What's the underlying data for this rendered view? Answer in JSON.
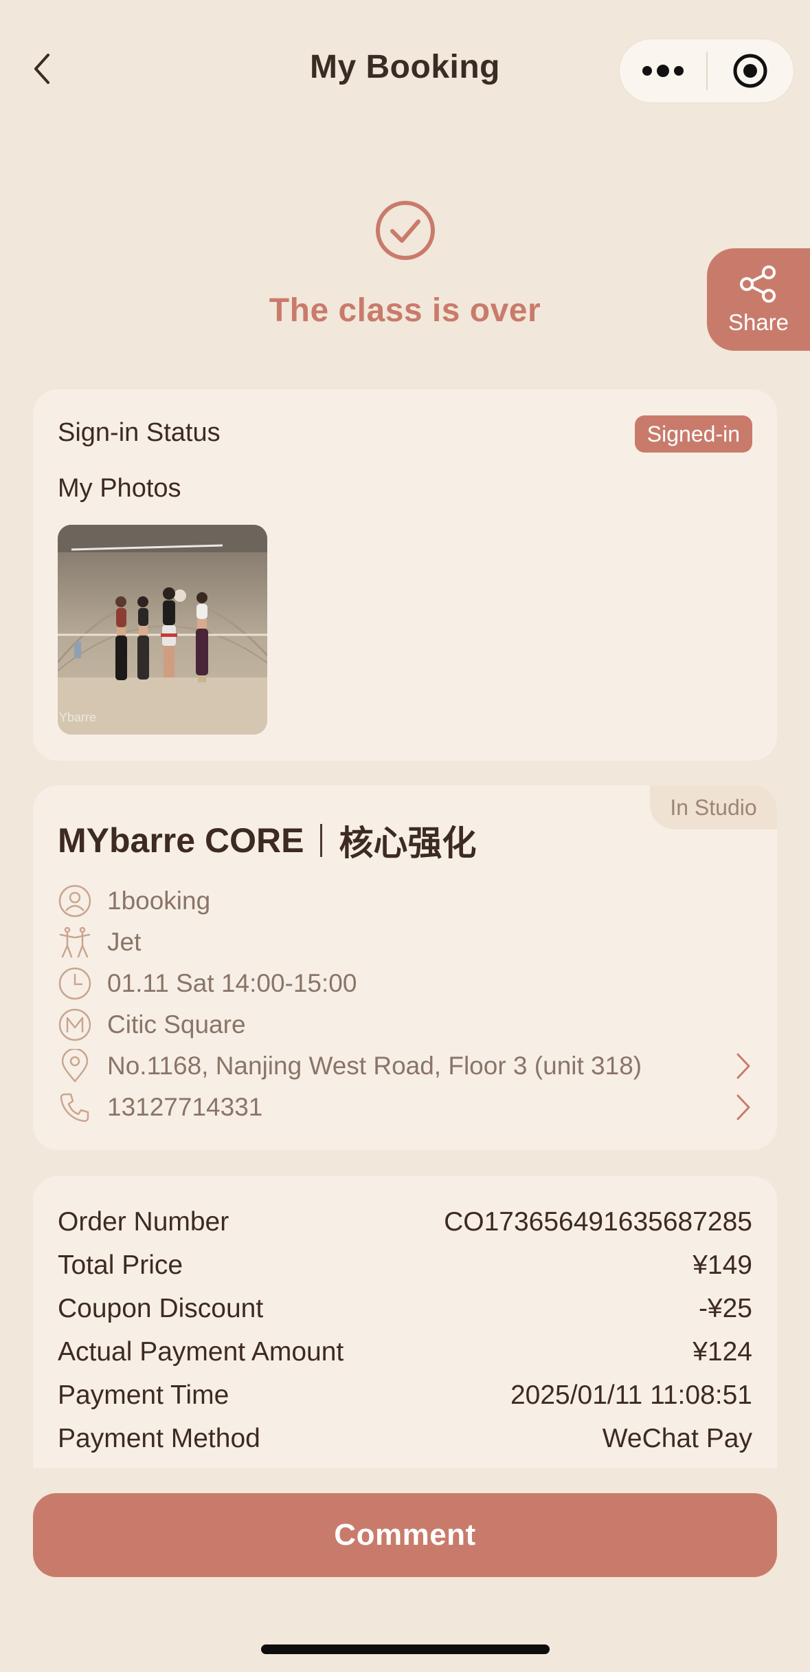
{
  "header": {
    "title": "My Booking"
  },
  "status": {
    "text": "The class is over"
  },
  "share": {
    "label": "Share"
  },
  "signin": {
    "label": "Sign-in Status",
    "badge": "Signed-in",
    "photos_label": "My Photos",
    "photo_watermark": "Ybarre"
  },
  "class_info": {
    "tag": "In Studio",
    "name": "MYbarre CORE",
    "name_cn": "核心强化",
    "source": "1booking",
    "instructor": "Jet",
    "time": "01.11 Sat 14:00-15:00",
    "studio": "Citic Square",
    "address": "No.1168, Nanjing West Road, Floor 3 (unit 318)",
    "phone": "13127714331"
  },
  "order": {
    "rows": [
      {
        "label": "Order Number",
        "value": "CO173656491635687285"
      },
      {
        "label": "Total Price",
        "value": "¥149"
      },
      {
        "label": "Coupon Discount",
        "value": "-¥25"
      },
      {
        "label": "Actual Payment Amount",
        "value": "¥124"
      },
      {
        "label": "Payment Time",
        "value": "2025/01/11 11:08:51"
      },
      {
        "label": "Payment Method",
        "value": "WeChat Pay"
      }
    ]
  },
  "actions": {
    "comment": "Comment"
  },
  "colors": {
    "background": "#f1e7da",
    "accent": "#c97b6b",
    "card": "#f7efe6",
    "text": "#3d2a23",
    "muted": "#8a7468"
  }
}
